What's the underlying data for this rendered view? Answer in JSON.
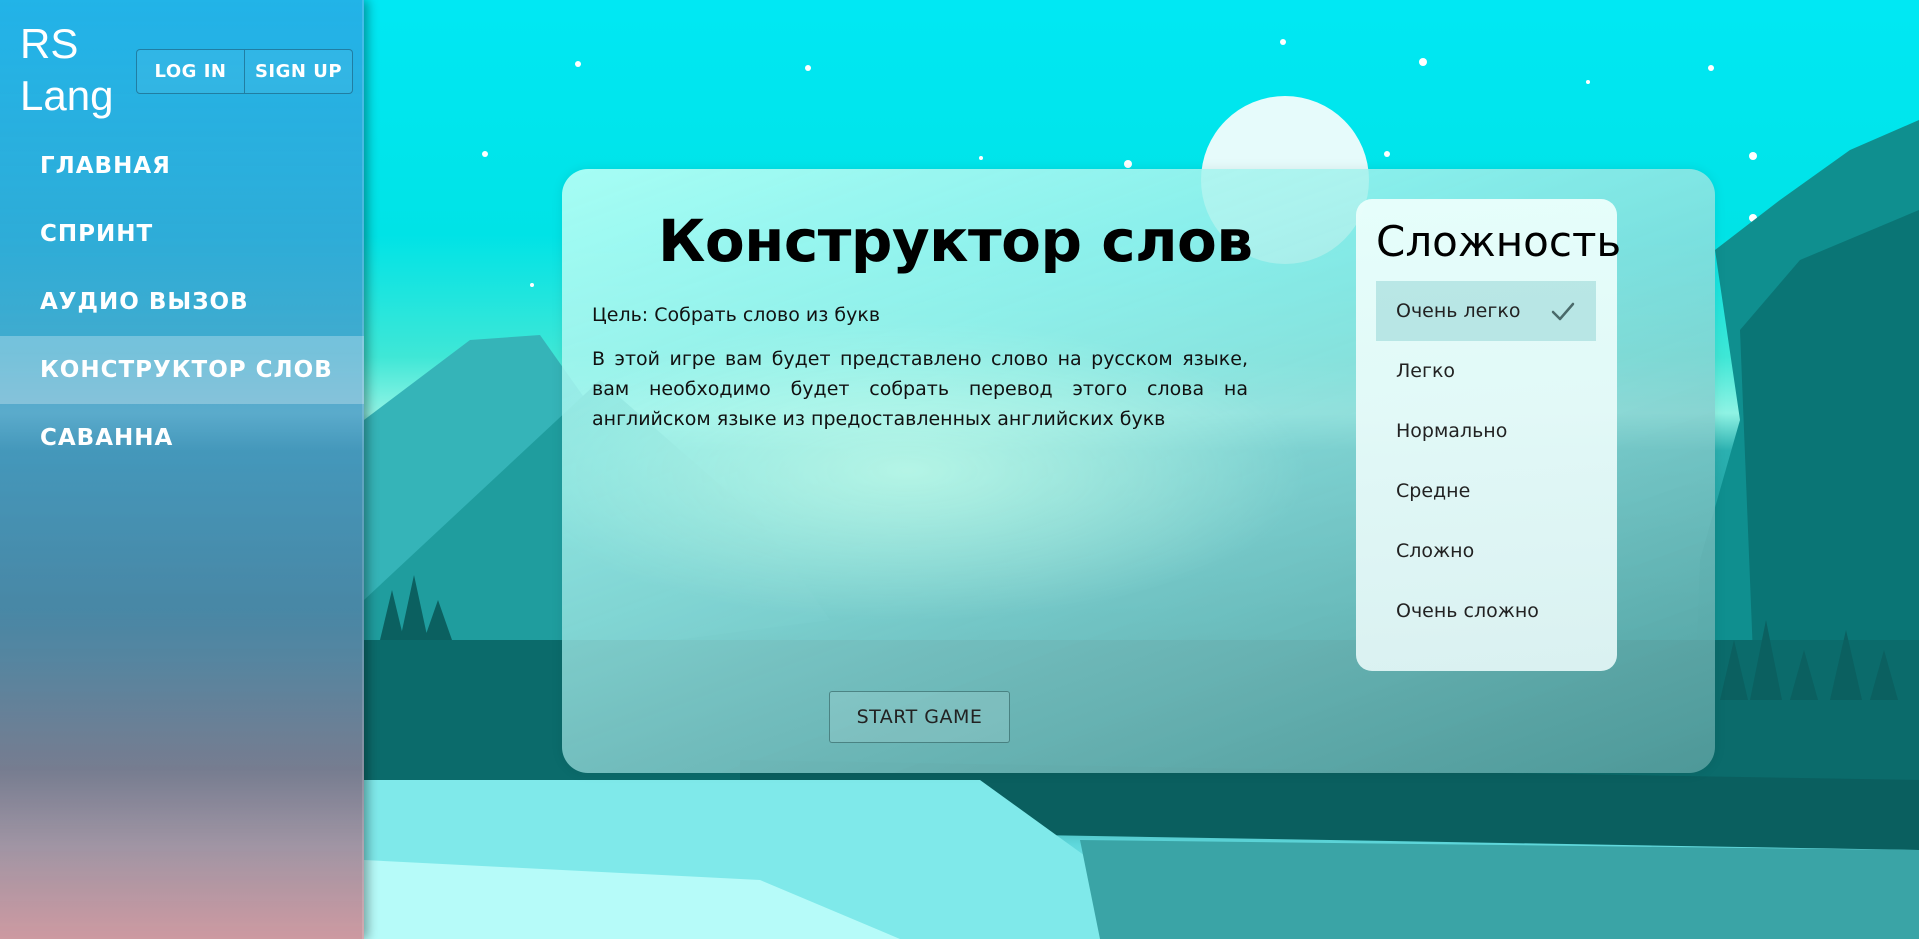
{
  "app": {
    "logo": "RS Lang"
  },
  "auth": {
    "login_label": "LOG IN",
    "signup_label": "SIGN UP"
  },
  "nav": {
    "items": [
      {
        "label": "ГЛАВНАЯ",
        "active": false
      },
      {
        "label": "СПРИНТ",
        "active": false
      },
      {
        "label": "АУДИО ВЫЗОВ",
        "active": false
      },
      {
        "label": "КОНСТРУКТОР СЛОВ",
        "active": true
      },
      {
        "label": "САВАННА",
        "active": false
      }
    ]
  },
  "game": {
    "title": "Конструктор слов",
    "goal": "Цель: Собрать слово из букв",
    "description": "В этой игре вам будет представлено слово на русском языке, вам необходимо будет собрать перевод этого слова на английском языке из предоставленных английских букв",
    "start_label": "START GAME"
  },
  "difficulty": {
    "title": "Сложность",
    "options": [
      {
        "label": "Очень легко",
        "selected": true
      },
      {
        "label": "Легко",
        "selected": false
      },
      {
        "label": "Нормально",
        "selected": false
      },
      {
        "label": "Средне",
        "selected": false
      },
      {
        "label": "Сложно",
        "selected": false
      },
      {
        "label": "Очень сложно",
        "selected": false
      }
    ]
  },
  "colors": {
    "sky": "#00e8f4",
    "accent_dark": "#0a6a6a"
  }
}
